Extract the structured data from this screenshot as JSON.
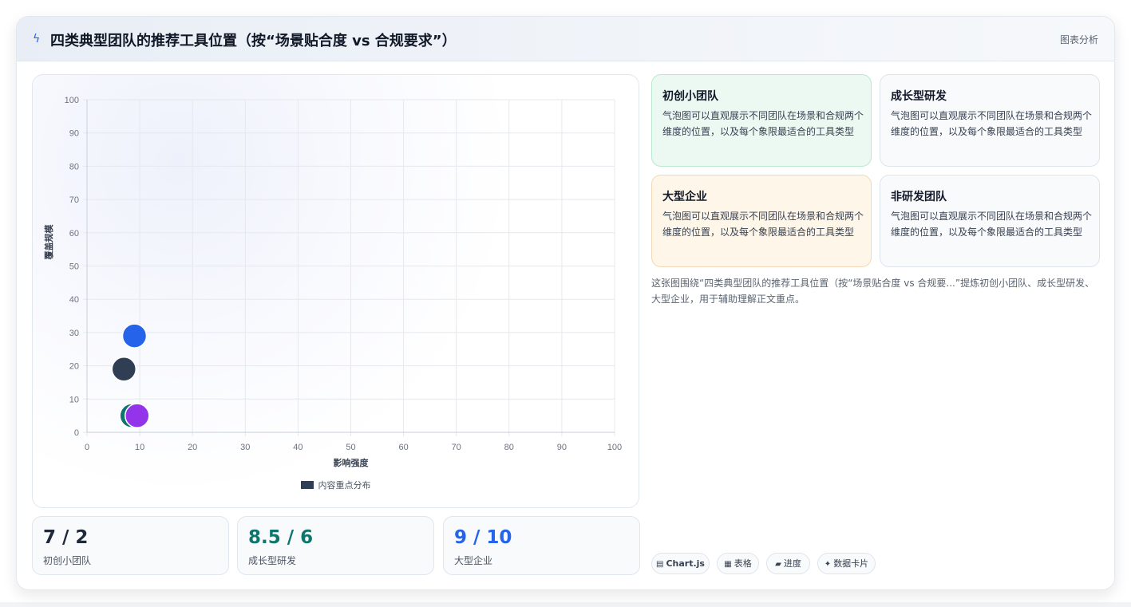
{
  "header": {
    "title": "四类典型团队的推荐工具位置（按“场景贴合度 vs 合规要求”）",
    "tag": "图表分析",
    "icon": "lightning-icon"
  },
  "chart_data": {
    "type": "scatter",
    "xlabel": "影响强度",
    "ylabel": "覆盖规模",
    "xlim": [
      0,
      100
    ],
    "ylim": [
      0,
      100
    ],
    "xticks": [
      "0",
      "10",
      "20",
      "30",
      "40",
      "50",
      "60",
      "70",
      "80",
      "90",
      "100"
    ],
    "yticks": [
      "0",
      "10",
      "20",
      "30",
      "40",
      "50",
      "60",
      "70",
      "80",
      "90",
      "100"
    ],
    "grid": true,
    "legend": [
      "内容重点分布"
    ],
    "legend_position": "bottom",
    "points": [
      {
        "x": 7,
        "y": 19,
        "color": "#2f3e52"
      },
      {
        "x": 9,
        "y": 29,
        "color": "#2563eb"
      },
      {
        "x": 8.5,
        "y": 5,
        "color": "#0f766e"
      },
      {
        "x": 9.5,
        "y": 5,
        "color": "#9333ea"
      }
    ]
  },
  "stats": [
    {
      "value": "7 / 2",
      "label": "初创小团队",
      "color": "#1f2937"
    },
    {
      "value": "8.5 / 6",
      "label": "成长型研发",
      "color": "#0f766e"
    },
    {
      "value": "9 / 10",
      "label": "大型企业",
      "color": "#2563eb"
    }
  ],
  "cards": [
    {
      "title": "初创小团队",
      "desc": "气泡图可以直观展示不同团队在场景和合规两个维度的位置，以及每个象限最适合的工具类型",
      "bg": "#ebf9f2",
      "border": "#b9e9cf"
    },
    {
      "title": "成长型研发",
      "desc": "气泡图可以直观展示不同团队在场景和合规两个维度的位置，以及每个象限最适合的工具类型",
      "bg": "#f8fafc",
      "border": "#dde4ec"
    },
    {
      "title": "大型企业",
      "desc": "气泡图可以直观展示不同团队在场景和合规两个维度的位置，以及每个象限最适合的工具类型",
      "bg": "#fff6ea",
      "border": "#f3d9b3"
    },
    {
      "title": "非研发团队",
      "desc": "气泡图可以直观展示不同团队在场景和合规两个维度的位置，以及每个象限最适合的工具类型",
      "bg": "#f8fafc",
      "border": "#dde4ec"
    }
  ],
  "summary": "这张图围绕“四类典型团队的推荐工具位置（按“场景贴合度 vs 合规要...”提炼初创小团队、成长型研发、大型企业，用于辅助理解正文重点。",
  "chips": [
    {
      "icon": "chart-icon",
      "glyph": "▤",
      "label": "Chart.js",
      "bold": true
    },
    {
      "icon": "table-icon",
      "glyph": "▦",
      "label": "表格",
      "bold": false
    },
    {
      "icon": "progress-icon",
      "glyph": "▰",
      "label": "进度",
      "bold": false
    },
    {
      "icon": "sparkle-icon",
      "glyph": "✦",
      "label": "数据卡片",
      "bold": false
    }
  ]
}
